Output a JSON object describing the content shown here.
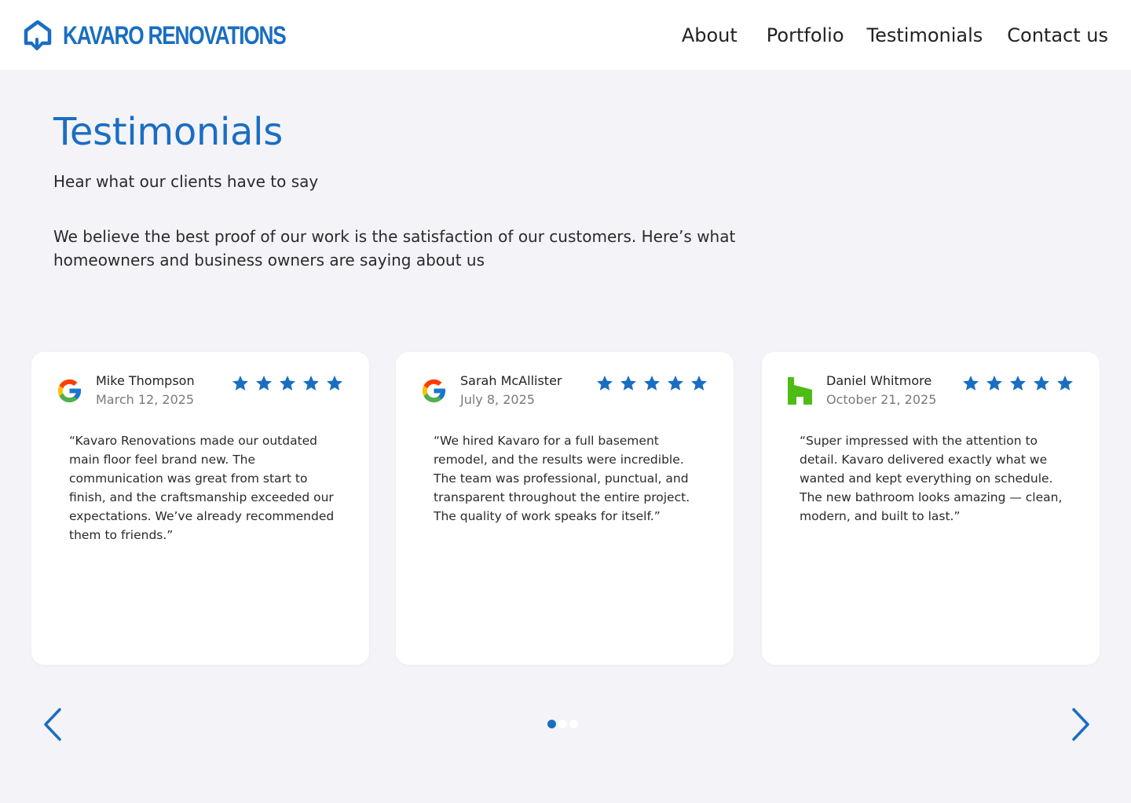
{
  "header": {
    "brand_name": "KAVARO RENOVATIONS",
    "brand_icon": "house-arrow-icon",
    "nav": {
      "about": "About",
      "portfolio": "Portfolio",
      "testimonials": "Testimonials",
      "contact": "Contact us"
    }
  },
  "intro": {
    "title": "Testimonials",
    "subtitle": "Hear what our clients have to say",
    "description": "We believe the best proof of our work is the satisfaction of our customers. Here’s what homeowners and business owners are saying about us"
  },
  "testimonials": [
    {
      "source_icon": "google-icon",
      "name": "Mike Thompson",
      "date": "March 12, 2025",
      "rating": 5,
      "text": "“Kavaro Renovations made our outdated main floor feel brand new. The communication was great from start to finish, and the craftsmanship exceeded our expectations. We’ve already recommended them to friends.”"
    },
    {
      "source_icon": "google-icon",
      "name": "Sarah McAllister",
      "date": "July 8, 2025",
      "rating": 5,
      "text": "“We hired Kavaro for a full basement remodel, and the results were incredible. The team was professional, punctual, and transparent throughout the entire project. The quality of work speaks for itself.”"
    },
    {
      "source_icon": "houzz-icon",
      "name": "Daniel Whitmore",
      "date": "October 21, 2025",
      "rating": 5,
      "text": "“Super impressed with the attention to detail. Kavaro delivered exactly what we wanted and kept everything on schedule. The new bathroom looks amazing — clean, modern, and built to last.”"
    }
  ],
  "carousel": {
    "prev_icon": "chevron-left-icon",
    "next_icon": "chevron-right-icon",
    "page_count": 3,
    "active_page": 1
  },
  "colors": {
    "accent": "#1a6ec1",
    "background": "#f4f3f8",
    "card": "#ffffff",
    "star": "#1a6ec1",
    "dot_active": "#1a6ec1",
    "dot_inactive": "#ffffff",
    "houzz_green": "#4dbc15"
  }
}
